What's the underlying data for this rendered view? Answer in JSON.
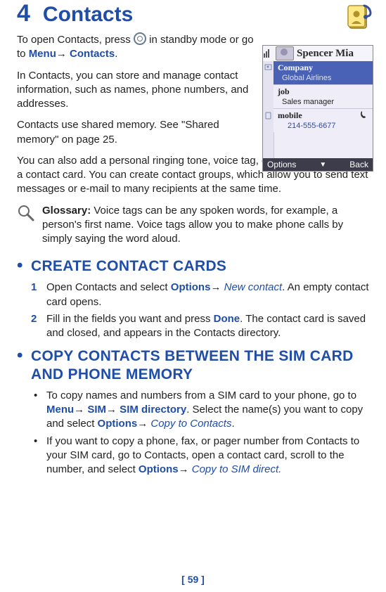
{
  "chapter": {
    "num": "4",
    "title": "Contacts"
  },
  "intro": {
    "p1a": "To open Contacts, press ",
    "p1b": " in standby mode or go to ",
    "menu": "Menu",
    "arrow": "→",
    "contacts": "Contacts",
    "period": ".",
    "p2": "In Contacts, you can store and manage contact information, such as names, phone numbers, and addresses.",
    "p3": "Contacts use shared memory.  See \"Shared memory\" on page 25.",
    "p4": "You can also add a personal ringing tone, voice tag, or a thumbnail image to a contact card. You can create contact groups, which allow you to send text messages or e-mail to many recipients at the same time."
  },
  "glossary": {
    "label": "Glossary:",
    "text": " Voice tags can be any spoken words, for example, a person's first name. Voice tags allow you to make phone calls by simply saying the word aloud."
  },
  "section1": {
    "title": "CREATE CONTACT CARDS",
    "steps": [
      {
        "n": "1",
        "before": "Open Contacts and select ",
        "opt": "Options",
        "arrow": "→",
        "cmd": " New contact",
        "after": ". An empty contact card opens."
      },
      {
        "n": "2",
        "before": "Fill in the fields you want and press ",
        "done": "Done",
        "after": ". The contact card is saved and closed, and appears in the Contacts directory."
      }
    ]
  },
  "section2": {
    "title": "COPY CONTACTS BETWEEN THE SIM CARD AND PHONE MEMORY",
    "bullets": [
      {
        "a": "To copy names and numbers from a SIM card to your phone, go to ",
        "menu": "Menu",
        "arr1": "→",
        "sim": " SIM",
        "arr2": "→",
        "simdir": " SIM directory",
        "b": ". Select the name(s) you want to copy and select ",
        "opt": "Options",
        "arr3": "→",
        "cmd": " Copy to Contacts",
        "end": "."
      },
      {
        "a": "If you want to copy a phone, fax, or pager number from Contacts to your SIM card, go to Contacts, open a contact card, scroll to the number, and select ",
        "opt": "Options",
        "arr": "→",
        "cmd": " Copy to SIM direct."
      }
    ]
  },
  "phone": {
    "name": "Spencer Mia",
    "company_label": "Company",
    "company_value": "Global Airlines",
    "job_label": "job",
    "job_value": "Sales manager",
    "mobile_label": "mobile",
    "mobile_value": "214-555-6677",
    "options": "Options",
    "back": "Back"
  },
  "footer": "[ 59 ]"
}
